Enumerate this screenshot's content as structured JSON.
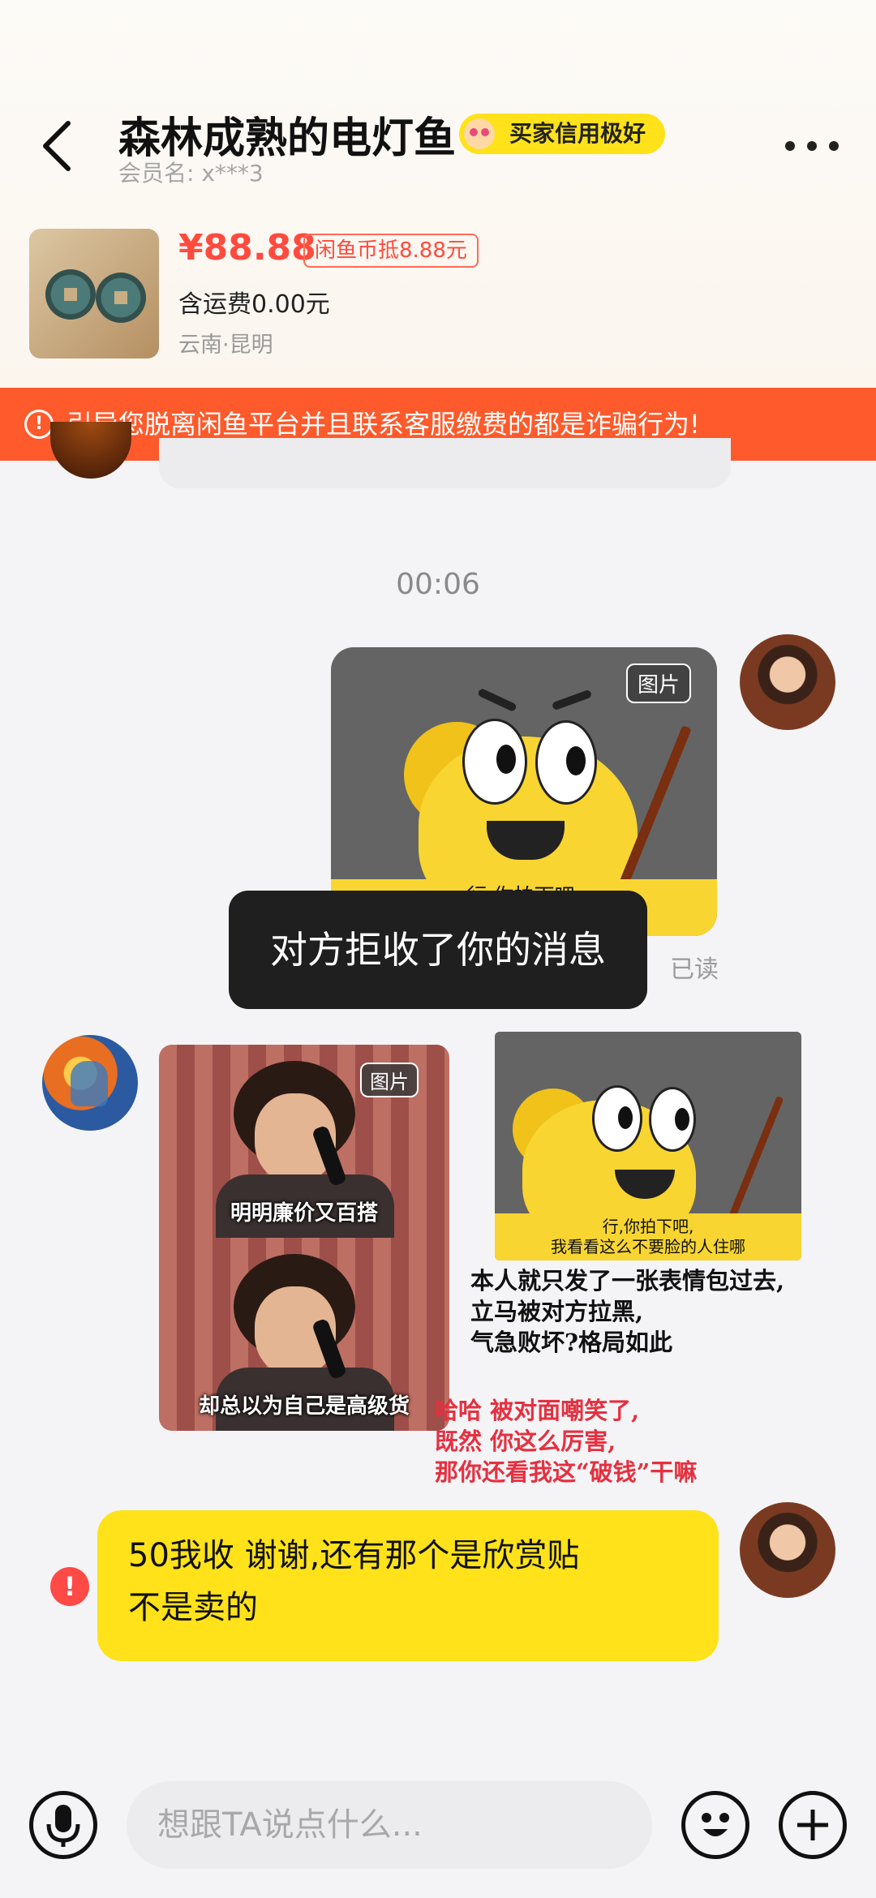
{
  "header": {
    "title": "森林成熟的电灯鱼",
    "credit_badge": "买家信用极好",
    "member_label": "会员名: x***3"
  },
  "item": {
    "price": "¥88.88",
    "coupon": "闲鱼币抵8.88元",
    "shipping": "含运费0.00元",
    "location": "云南·昆明"
  },
  "warning": {
    "text": "引导您脱离闲鱼平台并且联系客服缴费的都是诈骗行为!"
  },
  "chat": {
    "timestamp": "00:06",
    "image_tag": "图片",
    "sticker_caption_1": "行,你拍下吧,",
    "sticker_caption_2": "我看看这么不要脸的人住哪",
    "toast": "对方拒收了你的消息",
    "read_status": "已读",
    "meme_caption_top": "明明廉价又百搭",
    "meme_caption_bottom": "却总以为自己是高级货",
    "overlay_black": [
      "本人就只发了一张表情包过去,",
      "立马被对方拉黑,",
      "气急败坏?格局如此"
    ],
    "overlay_red": [
      "哈哈 被对面嘲笑了,",
      "既然 你这么厉害,",
      "那你还看我这“破钱”干嘛"
    ],
    "my_message_line1": "50我收 谢谢,还有那个是欣赏贴",
    "my_message_line2": "不是卖的",
    "alert_symbol": "!"
  },
  "input": {
    "placeholder": "想跟TA说点什么..."
  },
  "colors": {
    "accent_yellow": "#ffe21a",
    "price_red": "#ff4b3e",
    "warning_orange": "#ff5a2b"
  }
}
